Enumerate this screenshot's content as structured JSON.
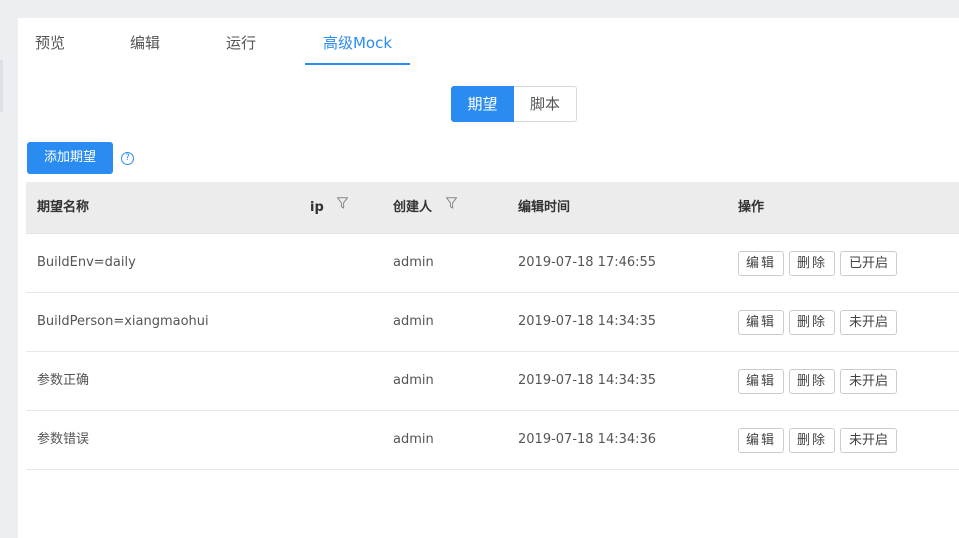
{
  "tabs": [
    "预览",
    "编辑",
    "运行",
    "高级Mock"
  ],
  "active_tab": "高级Mock",
  "segments": [
    "期望",
    "脚本"
  ],
  "add_button": "添加期望",
  "help_icon_label": "?",
  "columns": [
    "期望名称",
    "ip",
    "创建人",
    "编辑时间",
    "操作"
  ],
  "rows": [
    {
      "name": "BuildEnv=daily",
      "ip": "",
      "creator": "admin",
      "time": "2019-07-18 17:46:55",
      "edit": "编辑",
      "delete": "删除",
      "status": "已开启"
    },
    {
      "name": "BuildPerson=xiangmaohui",
      "ip": "",
      "creator": "admin",
      "time": "2019-07-18 14:34:35",
      "edit": "编辑",
      "delete": "删除",
      "status": "未开启"
    },
    {
      "name": "参数正确",
      "ip": "",
      "creator": "admin",
      "time": "2019-07-18 14:34:35",
      "edit": "编辑",
      "delete": "删除",
      "status": "未开启"
    },
    {
      "name": "参数错误",
      "ip": "",
      "creator": "admin",
      "time": "2019-07-18 14:34:36",
      "edit": "编辑",
      "delete": "删除",
      "status": "未开启"
    }
  ],
  "colors": {
    "primary": "#2a8cf0",
    "header_bg": "#ececec"
  },
  "icons": {
    "filter": "filter-icon",
    "help": "question-circle-icon"
  }
}
